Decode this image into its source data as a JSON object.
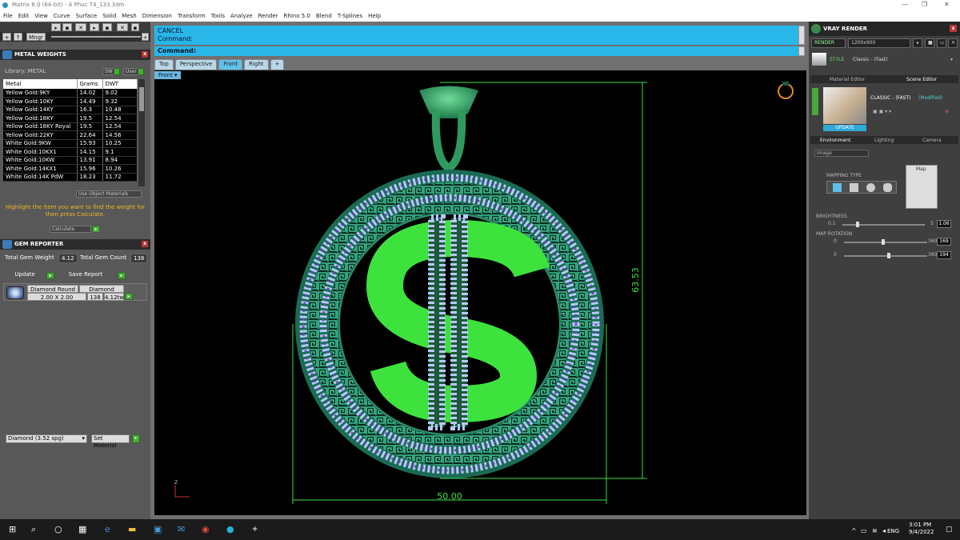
{
  "window": {
    "title": "Matrix 8.0 (64-bit) - A Phuc T4_133.3dm",
    "controls": [
      "—",
      "❐",
      "✕"
    ]
  },
  "menu": [
    "File",
    "Edit",
    "View",
    "Curve",
    "Surface",
    "Solid",
    "Mesh",
    "Dimension",
    "Transform",
    "Tools",
    "Analyze",
    "Render",
    "Rhino 5.0",
    "Blend",
    "T-Splines",
    "Help"
  ],
  "toolbar": {
    "mngr_label": "Mngr"
  },
  "metal_weights": {
    "title": "METAL WEIGHTS",
    "library_label": "Library: METAL",
    "sw_label": "SW",
    "user_label": "User",
    "columns": [
      "Metal",
      "Grams",
      "DWT"
    ],
    "rows": [
      [
        "Yellow Gold:9KY",
        "14.02",
        "9.02"
      ],
      [
        "Yellow Gold:10KY",
        "14.49",
        "9.32"
      ],
      [
        "Yellow Gold:14KY",
        "16.3",
        "10.48"
      ],
      [
        "Yellow Gold:18KY",
        "19.5",
        "12.54"
      ],
      [
        "Yellow Gold:18KY Royal",
        "19.5",
        "12.54"
      ],
      [
        "Yellow Gold:22KY",
        "22.64",
        "14.56"
      ],
      [
        "White Gold:9KW",
        "15.93",
        "10.25"
      ],
      [
        "White Gold:10KX1",
        "14.15",
        "9.1"
      ],
      [
        "White Gold:10KW",
        "13.91",
        "8.94"
      ],
      [
        "White Gold:14KX1",
        "15.96",
        "10.26"
      ],
      [
        "White Gold:14K PdW",
        "18.23",
        "11.72"
      ]
    ],
    "use_object_materials": "Use Object Materials",
    "hint": "Highlight the item you want to find the weight for then press Calculate.",
    "calculate_label": "Calculate"
  },
  "gem_reporter": {
    "title": "GEM REPORTER",
    "total_weight_label": "Total Gem Weight",
    "total_weight_value": "4.12",
    "total_count_label": "Total Gem Count",
    "total_count_value": "138",
    "update_label": "Update",
    "save_report_label": "Save Report",
    "gem": {
      "shape": "Diamond Round",
      "material": "Diamond",
      "size": "2.00 X 2.00",
      "count": "138",
      "weight": "4.12tw"
    },
    "material_select": "Diamond    (3.52 spg)",
    "set_material_label": "Set Material"
  },
  "command": {
    "cancel": "CANCEL",
    "line1": "Command:",
    "prompt": "Command:"
  },
  "viewport_tabs": [
    "Top",
    "Perspective",
    "Front",
    "Right",
    "+"
  ],
  "active_tab": "Front",
  "viewport_label": "Front",
  "dimensions": {
    "width": "50.00",
    "height": "63.53"
  },
  "axis_label": "Z",
  "vray": {
    "title": "VRAY RENDER",
    "render_label": "RENDER",
    "resolution": "1200x900",
    "style_label": "STYLE",
    "style_value": "Classic - (Fast)",
    "subtabs": [
      "Material Editor",
      "Scene Editor"
    ],
    "preset_name": "CLASSIC - (FAST)",
    "preset_state": "(Modified)",
    "update_label": "UPDATE",
    "env_tabs": [
      "Environment",
      "Lighting",
      "Camera"
    ],
    "env_type": "Image",
    "mapping_type_label": "MAPPING TYPE",
    "map_label": "Map",
    "brightness_label": "BRIGHTNESS",
    "brightness_min": "0.1",
    "brightness_max": "5",
    "brightness_value": "1.06",
    "map_rotation_label": "MAP ROTATION",
    "rot1_min": "0",
    "rot1_max": "360",
    "rot1_value": "169",
    "rot2_min": "0",
    "rot2_max": "360",
    "rot2_value": "194"
  },
  "taskbar": {
    "time": "3:01 PM",
    "date": "9/4/2022",
    "lang": "ENG"
  }
}
